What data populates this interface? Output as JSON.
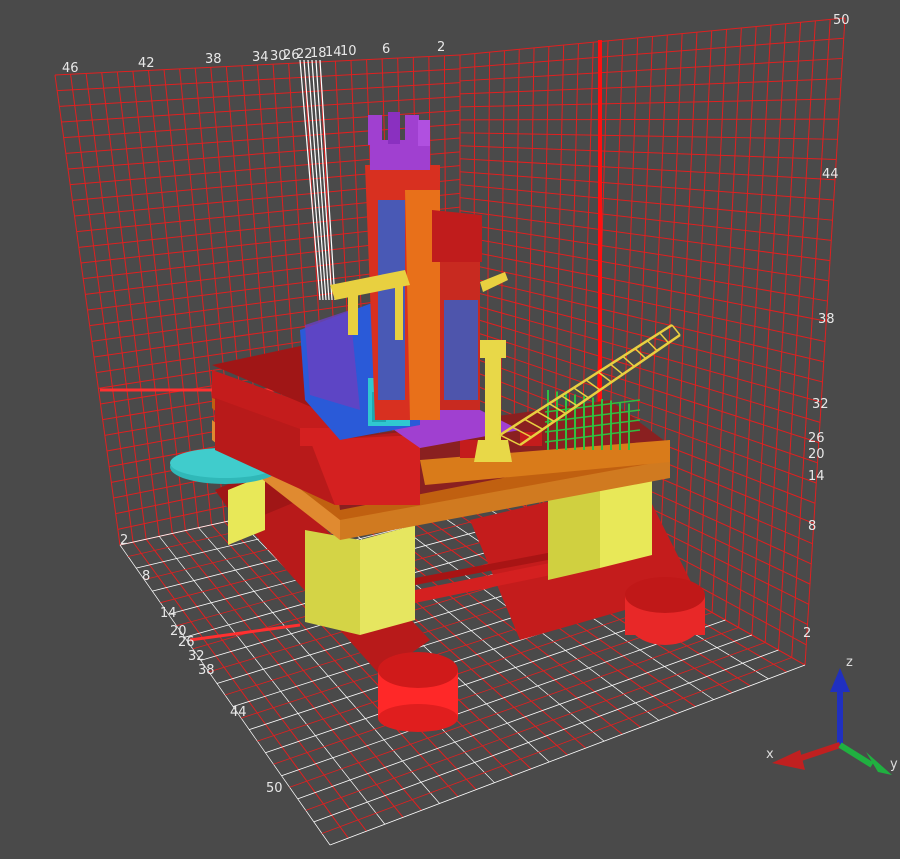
{
  "scene": {
    "background": "#4a4a4a",
    "grid_color": "#e02020",
    "grid_highlight": "#ffffff",
    "colors": {
      "hull": "#c41c1c",
      "hull_light": "#ff3030",
      "hull_dark": "#8a1010",
      "column": "#d8d84a",
      "column_dark": "#b8b830",
      "deck": "#d97b1a",
      "deck_dark": "#b05e10",
      "derrick": "#e03020",
      "crown": "#a040d0",
      "equipment_blue": "#2a5ad8",
      "equipment_cyan": "#30c8d0",
      "crane": "#e8d040",
      "green_rack": "#30c040",
      "helipad": "#30b8b8"
    }
  },
  "axis_labels": {
    "back_top": [
      "46",
      "42",
      "38",
      "34",
      "30",
      "26",
      "22",
      "18",
      "14",
      "10",
      "6",
      "2"
    ],
    "right_side": [
      "50",
      "44",
      "38",
      "32",
      "26",
      "20",
      "14",
      "8",
      "2"
    ],
    "left_floor": [
      "2",
      "8",
      "14",
      "20",
      "26",
      "32",
      "38",
      "44",
      "50"
    ]
  },
  "triad": {
    "x_label": "x",
    "y_label": "y",
    "z_label": "z",
    "x_color": "#c02020",
    "y_color": "#20b040",
    "z_color": "#2030c0"
  }
}
